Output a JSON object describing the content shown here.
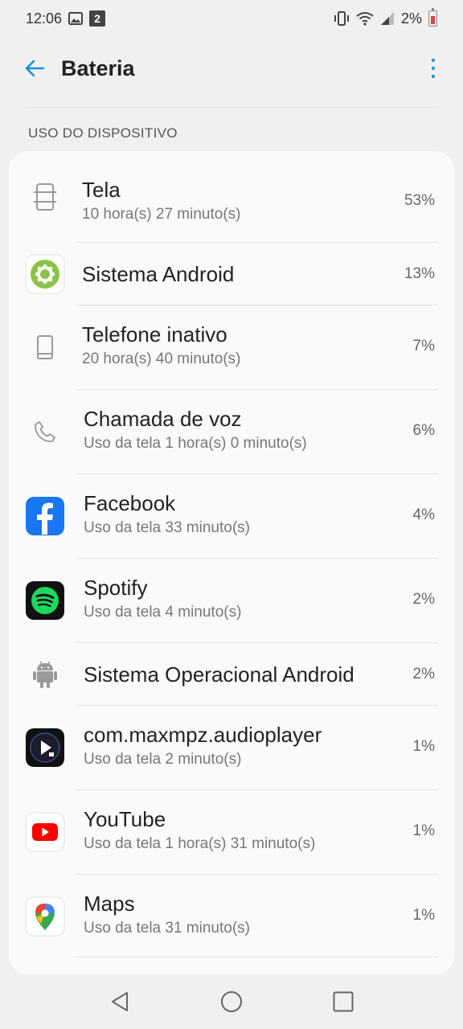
{
  "status_bar": {
    "time": "12:06",
    "notification_count": "2",
    "battery_percent": "2%",
    "icons": [
      "image-icon",
      "vibrate-icon",
      "wifi-icon",
      "signal-icon",
      "battery-icon"
    ]
  },
  "app_bar": {
    "title": "Bateria",
    "back_icon": "arrow-back-icon",
    "menu_icon": "more-vert-icon",
    "accent_color": "#1a8fd6"
  },
  "section_header": "USO DO DISPOSITIVO",
  "usage_items": [
    {
      "icon": "screen-icon",
      "title": "Tela",
      "subtitle": "10 hora(s) 27 minuto(s)",
      "percent": "53%"
    },
    {
      "icon": "android-system-icon",
      "title": "Sistema Android",
      "subtitle": "",
      "percent": "13%"
    },
    {
      "icon": "phone-idle-icon",
      "title": "Telefone inativo",
      "subtitle": "20 hora(s) 40 minuto(s)",
      "percent": "7%"
    },
    {
      "icon": "call-icon",
      "title": "Chamada de voz",
      "subtitle": "Uso da tela 1 hora(s) 0 minuto(s)",
      "percent": "6%"
    },
    {
      "icon": "facebook-icon",
      "title": "Facebook",
      "subtitle": "Uso da tela 33 minuto(s)",
      "percent": "4%"
    },
    {
      "icon": "spotify-icon",
      "title": "Spotify",
      "subtitle": "Uso da tela 4 minuto(s)",
      "percent": "2%"
    },
    {
      "icon": "android-os-icon",
      "title": "Sistema Operacional Android",
      "subtitle": "",
      "percent": "2%"
    },
    {
      "icon": "audioplayer-icon",
      "title": "com.maxmpz.audioplayer",
      "subtitle": "Uso da tela 2 minuto(s)",
      "percent": "1%"
    },
    {
      "icon": "youtube-icon",
      "title": "YouTube",
      "subtitle": "Uso da tela 1 hora(s) 31 minuto(s)",
      "percent": "1%"
    },
    {
      "icon": "maps-icon",
      "title": "Maps",
      "subtitle": "Uso da tela 31 minuto(s)",
      "percent": "1%"
    }
  ],
  "nav_bar": {
    "icons": [
      "nav-back-icon",
      "nav-home-icon",
      "nav-recents-icon"
    ]
  }
}
